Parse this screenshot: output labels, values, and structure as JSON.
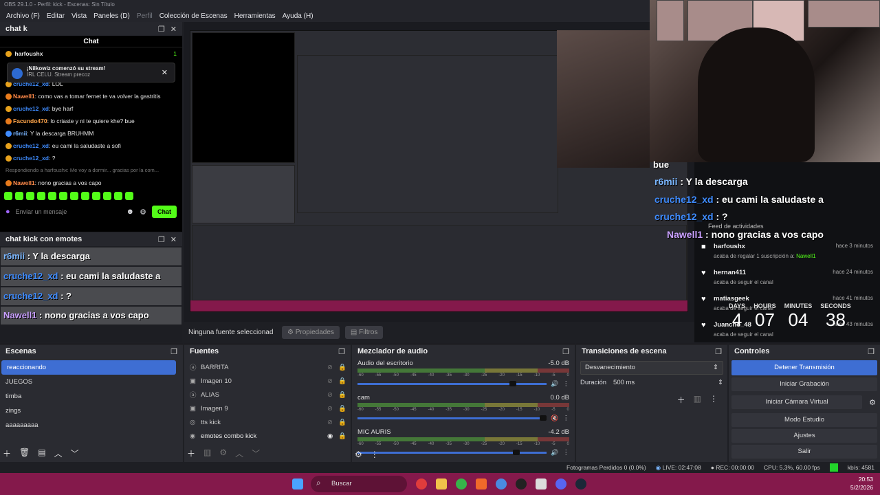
{
  "titlebar": {
    "title": "OBS 29.1.0 - Perfil: kick - Escenas: Sin Título"
  },
  "menu": [
    "Archivo (F)",
    "Editar",
    "Vista",
    "Paneles (D)",
    "Perfil",
    "Colección de Escenas",
    "Herramientas",
    "Ayuda (H)"
  ],
  "chat_dock": {
    "title": "chat k",
    "header": "Chat",
    "pinned": {
      "user": "harfoushx",
      "count": "1"
    },
    "notification": {
      "title": "¡Nilkowiz comenzó su stream!",
      "sub": "IRL CELU. Stream precoz"
    },
    "messages": [
      {
        "user": "cruche12_xd",
        "text": ": LOL",
        "color": "#3f8cff"
      },
      {
        "user": "Nawell1",
        "text": ": como vas a tomar fernet te va volver la gastritis",
        "color": "#ff8a4a"
      },
      {
        "user": "cruche12_xd",
        "text": ": bye harf",
        "color": "#3f8cff"
      },
      {
        "user": "Facundo470",
        "text": ": lo criaste y ni te quiere khe? bue",
        "color": "#ffa54a"
      },
      {
        "user": "r6mii",
        "text": ": Y la descarga BRUHMM",
        "color": "#7ab6ff"
      },
      {
        "user": "cruche12_xd",
        "text": ": eu cami la saludaste a sofi",
        "color": "#3f8cff"
      },
      {
        "user": "cruche12_xd",
        "text": ": ?",
        "color": "#3f8cff"
      }
    ],
    "reply": "Respondiendo a harfoushx: Me voy a dormir... gracias por la com...",
    "last": {
      "user": "Nawell1",
      "text": ": nono gracias a vos capo"
    },
    "input_placeholder": "Enviar un mensaje",
    "send": "Chat"
  },
  "emote_dock": {
    "title": "chat kick con emotes",
    "messages": [
      {
        "user": "r6mii",
        "text": " : Y la descarga"
      },
      {
        "user": "cruche12_xd",
        "text": " : eu cami la saludaste a"
      },
      {
        "user": "cruche12_xd",
        "text": " : ?"
      },
      {
        "user": "Nawell1",
        "text": " : nono gracias a vos capo"
      }
    ]
  },
  "overlay": {
    "lines": [
      {
        "user": "bue",
        "text": ""
      },
      {
        "user": "r6mii",
        "text": " : Y la descarga"
      },
      {
        "user": "cruche12_xd",
        "text": " : eu cami la saludaste a"
      },
      {
        "user": "cruche12_xd",
        "text": " : ?"
      },
      {
        "user": "Nawell1",
        "text": " : nono gracias a vos capo"
      }
    ],
    "feed_title": "Feed de actividades",
    "feed": [
      {
        "name": "harfoushx",
        "sub": "acaba de regalar 1 suscripción a: ",
        "highlight": "Nawell1",
        "time": "hace 3 minutos"
      },
      {
        "name": "hernan411",
        "sub": "acaba de seguir el canal",
        "time": "hace 24 minutos"
      },
      {
        "name": "matiasgeek",
        "sub": "acaba de seguir el canal",
        "time": "hace 41 minutos"
      },
      {
        "name": "Juancho_48",
        "sub": "acaba de seguir el canal",
        "time": "hace 43 minutos"
      }
    ],
    "countdown": {
      "labels": [
        "DAYS",
        "HOURS",
        "MINUTES",
        "SECONDS"
      ],
      "values": [
        "4",
        "07",
        "04",
        "38"
      ]
    }
  },
  "source_bar": {
    "label": "Ninguna fuente seleccionad",
    "props": "Propiedades",
    "filters": "Filtros"
  },
  "scenes": {
    "title": "Escenas",
    "items": [
      "reaccionando",
      "JUEGOS",
      "timba",
      "zings",
      "aaaaaaaaa"
    ]
  },
  "sources": {
    "title": "Fuentes",
    "items": [
      "BARRITA",
      "Imagen 10",
      "ALIAS",
      "Imagen 9",
      "tts kick",
      "emotes combo kick"
    ]
  },
  "mixer": {
    "title": "Mezclador de audio",
    "channels": [
      {
        "name": "Audio del escritorio",
        "db": "-5.0 dB",
        "level": 0.82
      },
      {
        "name": "cam",
        "db": "0.0 dB",
        "level": 0.98
      },
      {
        "name": "MIC AURIS",
        "db": "-4.2 dB",
        "level": 0.84
      }
    ],
    "ticks": [
      "-60",
      "-55",
      "-50",
      "-45",
      "-40",
      "-35",
      "-30",
      "-25",
      "-20",
      "-15",
      "-10",
      "-5",
      "0"
    ]
  },
  "transitions": {
    "title": "Transiciones de escena",
    "selected": "Desvanecimiento",
    "duration_label": "Duración",
    "duration": "500 ms"
  },
  "controls": {
    "title": "Controles",
    "buttons": [
      "Detener Transmisión",
      "Iniciar Grabación",
      "Iniciar Cámara Virtual",
      "Modo Estudio",
      "Ajustes",
      "Salir"
    ]
  },
  "status": {
    "dropped": "Fotogramas Perdidos 0 (0.0%)",
    "live": "LIVE: 02:47:08",
    "rec": "REC: 00:00:00",
    "cpu": "CPU: 5.3%, 60.00 fps",
    "kbs": "kb/s: 4581"
  },
  "taskbar": {
    "search": "Buscar",
    "time": "20:53",
    "date": "5/2/2026"
  },
  "colors": {
    "kick_green": "#53fc18",
    "accent_blue": "#3e6ed3",
    "taskbar": "#84194b"
  }
}
